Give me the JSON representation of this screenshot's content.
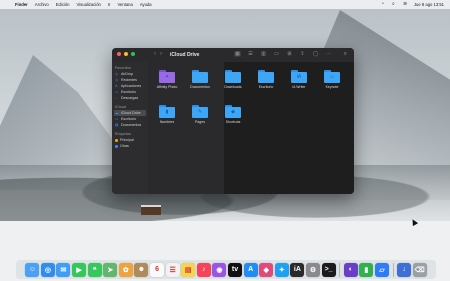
{
  "menubar": {
    "apple_glyph": "",
    "items": [
      "Finder",
      "Archivo",
      "Edición",
      "Visualización",
      "Ir",
      "Ventana",
      "Ayuda"
    ],
    "clock": "Jue 8 ago  13:51",
    "control_glyph": "≋",
    "wifi_glyph": "◔",
    "search_glyph": "⌕"
  },
  "finder": {
    "title": "iCloud Drive",
    "nav": {
      "back": "‹",
      "forward": "›"
    },
    "toolbar_glyphs": [
      "▦",
      "☰",
      "▥",
      "▭",
      "⊞",
      "⇪",
      "◯",
      "⋯"
    ],
    "search_glyph": "⌕",
    "sidebar": {
      "favorites_label": "Favoritos",
      "favorites": [
        {
          "label": "AirDrop",
          "glyph": "◎"
        },
        {
          "label": "Recientes",
          "glyph": "◷"
        },
        {
          "label": "Aplicaciones",
          "glyph": "A"
        },
        {
          "label": "Escritorio",
          "glyph": "▭"
        },
        {
          "label": "Descargas",
          "glyph": "↓"
        }
      ],
      "icloud_label": "iCloud",
      "icloud": [
        {
          "label": "iCloud Drive",
          "glyph": "☁"
        },
        {
          "label": "Escritorio",
          "glyph": "▭"
        },
        {
          "label": "Documentos",
          "glyph": "▤"
        }
      ],
      "tags_label": "Etiquetas",
      "tags": [
        {
          "label": "Principal",
          "color": "#f5a623"
        },
        {
          "label": "Otras",
          "color": "#3d8cff"
        }
      ]
    },
    "files": [
      {
        "label": "Affinity Photo",
        "glyph": "✦",
        "color": "purple"
      },
      {
        "label": "Documentos",
        "glyph": "",
        "color": "blue"
      },
      {
        "label": "Downloads",
        "glyph": "",
        "color": "blue"
      },
      {
        "label": "Escritorio",
        "glyph": "",
        "color": "blue"
      },
      {
        "label": "iA Writer",
        "glyph": "iA",
        "color": "blue"
      },
      {
        "label": "Keynote",
        "glyph": "▱",
        "color": "blue"
      },
      {
        "label": "Numbers",
        "glyph": "▮",
        "color": "blue"
      },
      {
        "label": "Pages",
        "glyph": "✎",
        "color": "blue"
      },
      {
        "label": "Shortcuts",
        "glyph": "◆",
        "color": "blue"
      }
    ]
  },
  "dock": {
    "apps": [
      {
        "name": "finder",
        "glyph": "☺",
        "bg": "#4aa0f5"
      },
      {
        "name": "safari",
        "glyph": "◎",
        "bg": "#2f8cf0"
      },
      {
        "name": "mail",
        "glyph": "✉",
        "bg": "#3d9df7"
      },
      {
        "name": "facetime",
        "glyph": "▶",
        "bg": "#34c759"
      },
      {
        "name": "messages",
        "glyph": "❝",
        "bg": "#35c85a"
      },
      {
        "name": "maps",
        "glyph": "➤",
        "bg": "#61b86b"
      },
      {
        "name": "photos",
        "glyph": "✿",
        "bg": "#f0a23c"
      },
      {
        "name": "contacts",
        "glyph": "☻",
        "bg": "#b08a5a"
      },
      {
        "name": "calendar",
        "glyph": "6",
        "bg": "#fafafa"
      },
      {
        "name": "reminders",
        "glyph": "☰",
        "bg": "#f2f2f2"
      },
      {
        "name": "notes",
        "glyph": "▤",
        "bg": "#f6d54b"
      },
      {
        "name": "music",
        "glyph": "♪",
        "bg": "#f7425a"
      },
      {
        "name": "podcasts",
        "glyph": "◉",
        "bg": "#9b55e4"
      },
      {
        "name": "tv",
        "glyph": "tv",
        "bg": "#111111"
      },
      {
        "name": "appstore",
        "glyph": "A",
        "bg": "#1c8ef5"
      },
      {
        "name": "shortcuts",
        "glyph": "◆",
        "bg": "#e24a7a"
      },
      {
        "name": "twitter",
        "glyph": "✦",
        "bg": "#1da1f2"
      },
      {
        "name": "ia-writer",
        "glyph": "iA",
        "bg": "#2a2a2a"
      },
      {
        "name": "system-preferences",
        "glyph": "⚙",
        "bg": "#8a8a8e"
      },
      {
        "name": "terminal",
        "glyph": ">_",
        "bg": "#1b1b1b"
      },
      {
        "name": "affinity-photo",
        "glyph": "◐",
        "bg": "#6a3fc8"
      },
      {
        "name": "numbers",
        "glyph": "▮",
        "bg": "#2fb24c"
      },
      {
        "name": "keynote",
        "glyph": "▱",
        "bg": "#2e7cf6"
      },
      {
        "name": "downloads-stack",
        "glyph": "↓",
        "bg": "#3d6fd6"
      },
      {
        "name": "trash",
        "glyph": "⌫",
        "bg": "#9aa0a5"
      }
    ]
  }
}
